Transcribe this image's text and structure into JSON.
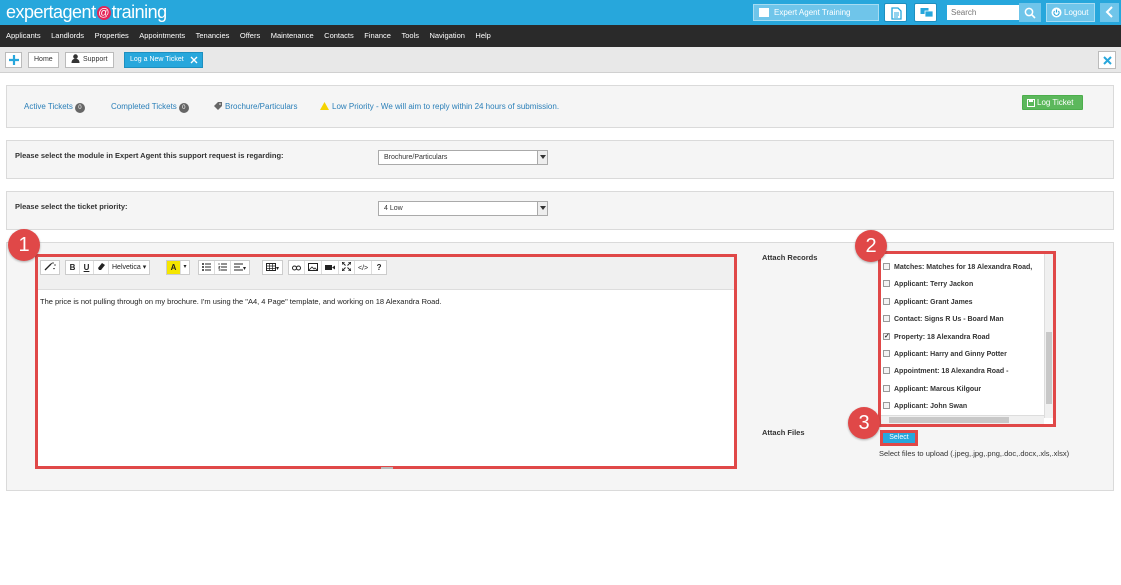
{
  "header": {
    "logo_part1": "expertagent",
    "logo_at": "@",
    "logo_part2": "training",
    "branch_label": "Expert Agent Training",
    "search_placeholder": "Search",
    "logout_label": "Logout",
    "accent_color": "#27a7dc"
  },
  "menu": [
    "Applicants",
    "Landlords",
    "Properties",
    "Appointments",
    "Tenancies",
    "Offers",
    "Maintenance",
    "Contacts",
    "Finance",
    "Tools",
    "Navigation",
    "Help"
  ],
  "tabs": {
    "home": "Home",
    "support": "Support",
    "active": "Log a New Ticket"
  },
  "tickets": {
    "active_label": "Active Tickets",
    "active_count": "0",
    "completed_label": "Completed Tickets",
    "completed_count": "0",
    "module_link": "Brochure/Particulars",
    "priority_title": "Low Priority",
    "priority_text": " - We will aim to reply within 24 hours of submission.",
    "log_button": "Log Ticket"
  },
  "form": {
    "module_label": "Please select the module in Expert Agent this support request is regarding:",
    "module_value": "Brochure/Particulars",
    "priority_label": "Please select the ticket priority:",
    "priority_value": "4 Low"
  },
  "editor": {
    "font_label": "Helvetica",
    "body_text": "The price is not pulling through on my brochure. I'm using the \"A4, 4 Page\" template, and working on 18 Alexandra Road."
  },
  "attach": {
    "records_label": "Attach Records",
    "files_label": "Attach Files",
    "records": [
      {
        "text": "Matches: Matches for 18 Alexandra Road,",
        "checked": false
      },
      {
        "text": "Applicant: Terry Jackon",
        "checked": false
      },
      {
        "text": "Applicant: Grant James",
        "checked": false
      },
      {
        "text": "Contact: Signs R Us - Board Man",
        "checked": false
      },
      {
        "text": "Property: 18 Alexandra Road",
        "checked": true
      },
      {
        "text": "Applicant: Harry and Ginny Potter",
        "checked": false
      },
      {
        "text": "Appointment: 18 Alexandra Road -",
        "checked": false
      },
      {
        "text": "Applicant: Marcus Kilgour",
        "checked": false
      },
      {
        "text": "Applicant: John Swan",
        "checked": false
      }
    ],
    "select_button": "Select",
    "files_hint": "Select files to upload (.jpeg,.jpg,.png,.doc,.docx,.xls,.xlsx)"
  },
  "callouts": [
    "1",
    "2",
    "3"
  ]
}
